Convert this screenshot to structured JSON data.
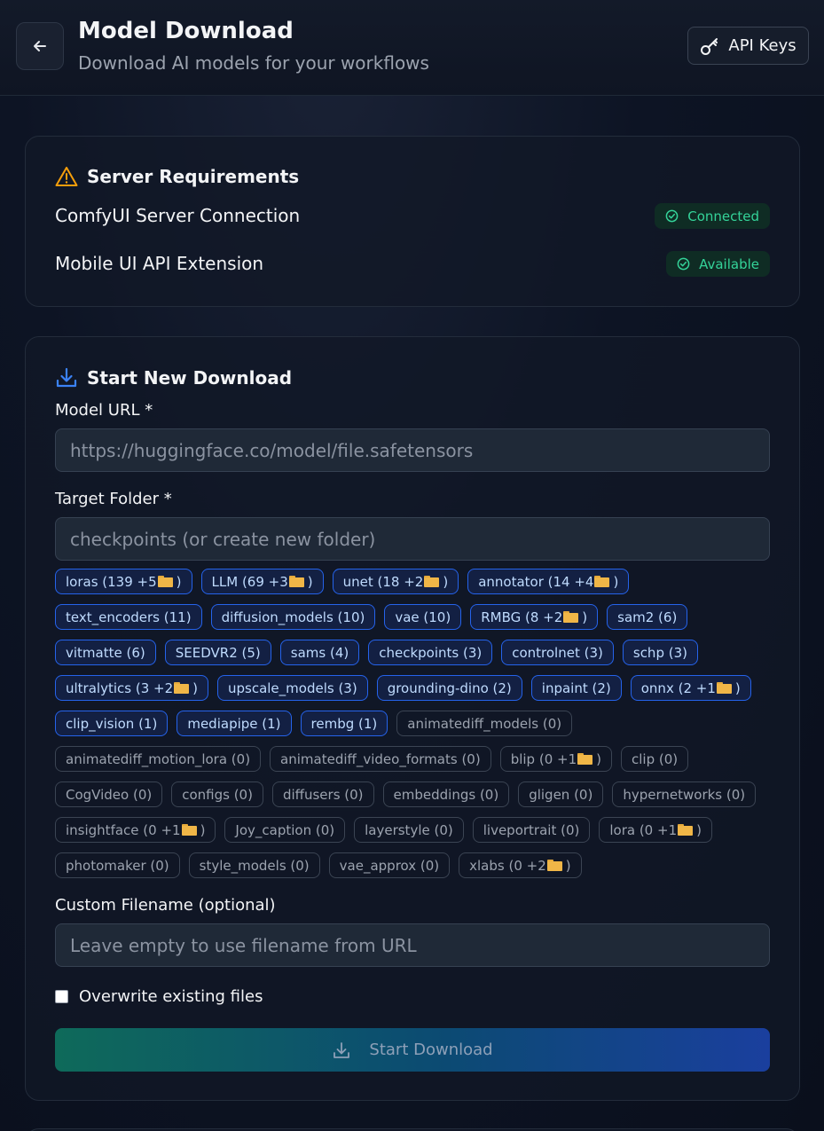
{
  "header": {
    "back_icon": "arrow-left-icon",
    "title": "Model Download",
    "subtitle": "Download AI models for your workflows",
    "api_keys_icon": "key-icon",
    "api_keys_label": "API Keys"
  },
  "requirements": {
    "title": "Server Requirements",
    "title_icon": "warning-triangle-icon",
    "items": [
      {
        "label": "ComfyUI Server Connection",
        "status": "Connected",
        "status_icon": "check-circle-icon"
      },
      {
        "label": "Mobile UI API Extension",
        "status": "Available",
        "status_icon": "check-circle-icon"
      }
    ]
  },
  "download": {
    "title": "Start New Download",
    "title_icon": "download-icon",
    "url_label": "Model URL *",
    "url_placeholder": "https://huggingface.co/model/file.safetensors",
    "folder_label": "Target Folder *",
    "folder_placeholder": "checkpoints (or create new folder)",
    "folders": [
      {
        "text": "loras (139 +5",
        "sub": true,
        "active": true
      },
      {
        "text": "LLM (69 +3",
        "sub": true,
        "active": true
      },
      {
        "text": "unet (18 +2",
        "sub": true,
        "active": true
      },
      {
        "text": "annotator (14 +4",
        "sub": true,
        "active": true
      },
      {
        "text": "text_encoders (11)",
        "sub": false,
        "active": true
      },
      {
        "text": "diffusion_models (10)",
        "sub": false,
        "active": true
      },
      {
        "text": "vae (10)",
        "sub": false,
        "active": true
      },
      {
        "text": "RMBG (8 +2",
        "sub": true,
        "active": true
      },
      {
        "text": "sam2 (6)",
        "sub": false,
        "active": true
      },
      {
        "text": "vitmatte (6)",
        "sub": false,
        "active": true
      },
      {
        "text": "SEEDVR2 (5)",
        "sub": false,
        "active": true
      },
      {
        "text": "sams (4)",
        "sub": false,
        "active": true
      },
      {
        "text": "checkpoints (3)",
        "sub": false,
        "active": true
      },
      {
        "text": "controlnet (3)",
        "sub": false,
        "active": true
      },
      {
        "text": "schp (3)",
        "sub": false,
        "active": true
      },
      {
        "text": "ultralytics (3 +2",
        "sub": true,
        "active": true
      },
      {
        "text": "upscale_models (3)",
        "sub": false,
        "active": true
      },
      {
        "text": "grounding-dino (2)",
        "sub": false,
        "active": true
      },
      {
        "text": "inpaint (2)",
        "sub": false,
        "active": true
      },
      {
        "text": "onnx (2 +1",
        "sub": true,
        "active": true
      },
      {
        "text": "clip_vision (1)",
        "sub": false,
        "active": true
      },
      {
        "text": "mediapipe (1)",
        "sub": false,
        "active": true
      },
      {
        "text": "rembg (1)",
        "sub": false,
        "active": true
      },
      {
        "text": "animatediff_models (0)",
        "sub": false,
        "active": false
      },
      {
        "text": "animatediff_motion_lora (0)",
        "sub": false,
        "active": false
      },
      {
        "text": "animatediff_video_formats (0)",
        "sub": false,
        "active": false
      },
      {
        "text": "blip (0 +1",
        "sub": true,
        "active": false
      },
      {
        "text": "clip (0)",
        "sub": false,
        "active": false
      },
      {
        "text": "CogVideo (0)",
        "sub": false,
        "active": false
      },
      {
        "text": "configs (0)",
        "sub": false,
        "active": false
      },
      {
        "text": "diffusers (0)",
        "sub": false,
        "active": false
      },
      {
        "text": "embeddings (0)",
        "sub": false,
        "active": false
      },
      {
        "text": "gligen (0)",
        "sub": false,
        "active": false
      },
      {
        "text": "hypernetworks (0)",
        "sub": false,
        "active": false
      },
      {
        "text": "insightface (0 +1",
        "sub": true,
        "active": false
      },
      {
        "text": "Joy_caption (0)",
        "sub": false,
        "active": false
      },
      {
        "text": "layerstyle (0)",
        "sub": false,
        "active": false
      },
      {
        "text": "liveportrait (0)",
        "sub": false,
        "active": false
      },
      {
        "text": "lora (0 +1",
        "sub": true,
        "active": false
      },
      {
        "text": "photomaker (0)",
        "sub": false,
        "active": false
      },
      {
        "text": "style_models (0)",
        "sub": false,
        "active": false
      },
      {
        "text": "vae_approx (0)",
        "sub": false,
        "active": false
      },
      {
        "text": "xlabs (0 +2",
        "sub": true,
        "active": false
      }
    ],
    "folder_suffix": ")",
    "subfolder_icon": "folder-icon",
    "filename_label": "Custom Filename (optional)",
    "filename_placeholder": "Leave empty to use filename from URL",
    "overwrite_label": "Overwrite existing files",
    "overwrite_checked": false,
    "button_label": "Start Download",
    "button_icon": "download-icon"
  },
  "colors": {
    "accent_blue": "#2563eb",
    "success_green": "#34d399",
    "warning_orange": "#f59e0b",
    "folder_yellow": "#f0b647"
  }
}
